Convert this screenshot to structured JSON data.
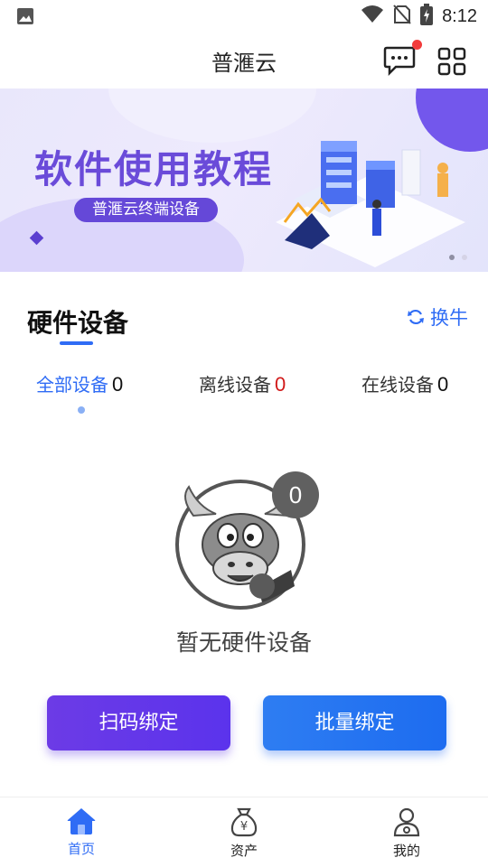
{
  "status_bar": {
    "time": "8:12"
  },
  "header": {
    "title": "普滙云"
  },
  "banner": {
    "title": "软件使用教程",
    "subtitle": "普滙云终端设备"
  },
  "section": {
    "title": "硬件设备",
    "swap_label": "换牛"
  },
  "tabs": [
    {
      "label": "全部设备",
      "count": "0"
    },
    {
      "label": "离线设备",
      "count": "0"
    },
    {
      "label": "在线设备",
      "count": "0"
    }
  ],
  "empty_state": {
    "badge": "0",
    "text": "暂无硬件设备"
  },
  "buttons": {
    "scan": "扫码绑定",
    "batch": "批量绑定"
  },
  "bottom_nav": [
    {
      "label": "首页",
      "icon": "home-icon"
    },
    {
      "label": "资产",
      "icon": "money-bag-icon"
    },
    {
      "label": "我的",
      "icon": "user-icon"
    }
  ],
  "colors": {
    "accent_blue": "#2f6cf5",
    "purple": "#6548d8",
    "offline_red": "#d11a1a",
    "notification_red": "#f23b3b"
  }
}
